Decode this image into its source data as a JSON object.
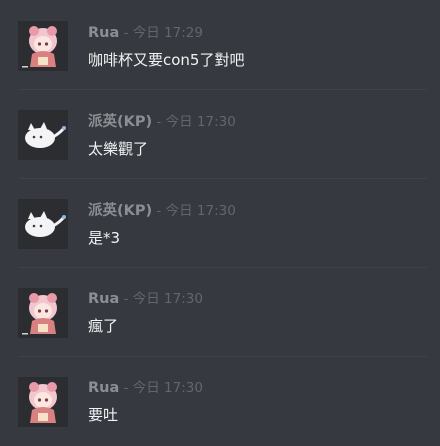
{
  "messages": [
    {
      "author": "Rua",
      "separator": " - ",
      "timestamp": "今日 17:29",
      "text": "咖啡杯又要con5了對吧",
      "avatar_icon": "anime-girl-avatar-icon"
    },
    {
      "author": "派英(KP)",
      "separator": " - ",
      "timestamp": "今日 17:30",
      "text": "太樂觀了",
      "avatar_icon": "white-cat-avatar-icon"
    },
    {
      "author": "派英(KP)",
      "separator": " - ",
      "timestamp": "今日 17:30",
      "text": "是*3",
      "avatar_icon": "white-cat-avatar-icon"
    },
    {
      "author": "Rua",
      "separator": " - ",
      "timestamp": "今日 17:30",
      "text": "瘋了",
      "avatar_icon": "anime-girl-avatar-icon"
    },
    {
      "author": "Rua",
      "separator": " - ",
      "timestamp": "今日 17:30",
      "text": "要吐",
      "avatar_icon": "anime-girl-avatar-icon"
    }
  ],
  "colors": {
    "background": "#36393f",
    "author": "#8b8e93",
    "timestamp": "#63666b",
    "text": "#f1f2f3"
  }
}
